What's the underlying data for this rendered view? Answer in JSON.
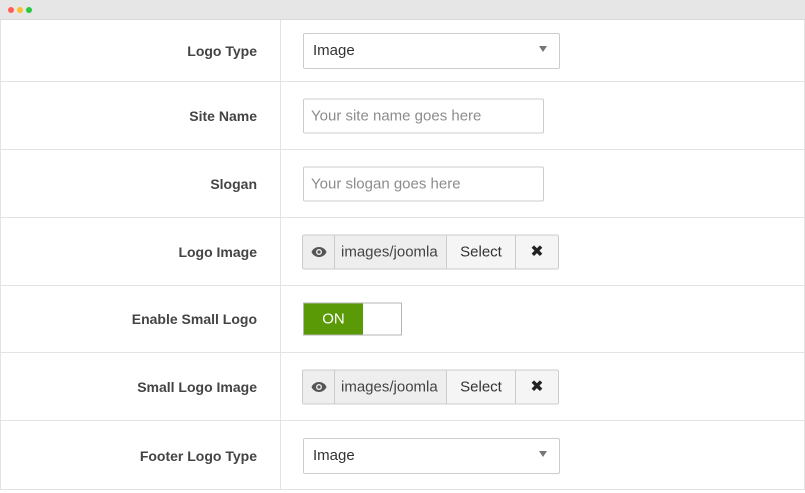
{
  "rows": [
    {
      "label": "Logo Type",
      "control": "select",
      "value": "Image"
    },
    {
      "label": "Site Name",
      "control": "input",
      "placeholder": "Your site name goes here"
    },
    {
      "label": "Slogan",
      "control": "input",
      "placeholder": "Your slogan goes here"
    },
    {
      "label": "Logo Image",
      "control": "media",
      "path": "images/joomla",
      "select_label": "Select",
      "clear_icon": "times-icon"
    },
    {
      "label": "Enable Small Logo",
      "control": "toggle",
      "state": "ON"
    },
    {
      "label": "Small Logo Image",
      "control": "media",
      "path": "images/joomla",
      "select_label": "Select",
      "clear_icon": "times-icon"
    },
    {
      "label": "Footer Logo Type",
      "control": "select",
      "value": "Image"
    }
  ],
  "colors": {
    "toggle_on": "#5a9a07",
    "border": "#cccccc",
    "divider": "#e3e3e3"
  }
}
